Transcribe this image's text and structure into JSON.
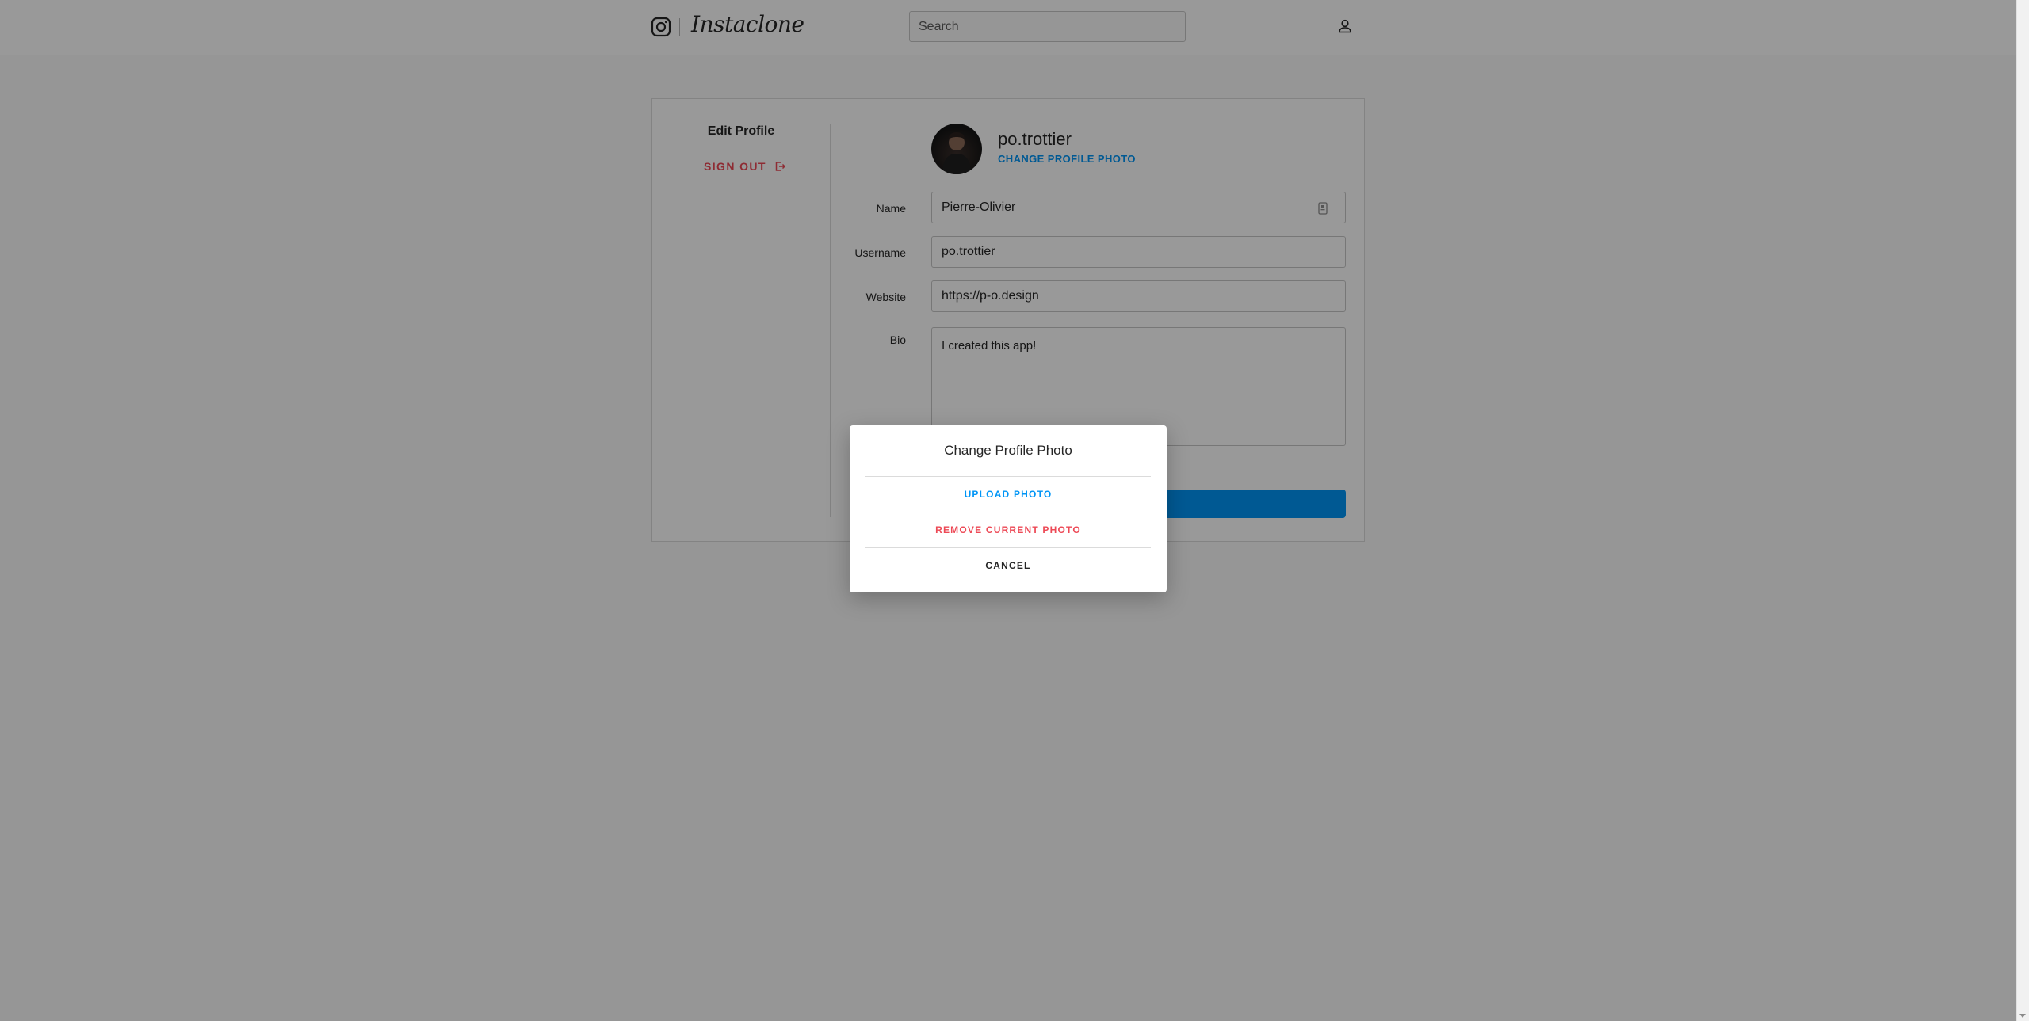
{
  "header": {
    "app_name": "Instaclone",
    "search_placeholder": "Search"
  },
  "sidebar": {
    "title": "Edit Profile",
    "sign_out": "SIGN OUT"
  },
  "profile": {
    "username": "po.trottier",
    "change_photo": "CHANGE PROFILE PHOTO",
    "fields": {
      "name_label": "Name",
      "name_value": "Pierre-Olivier",
      "username_label": "Username",
      "username_value": "po.trottier",
      "website_label": "Website",
      "website_value": "https://p-o.design",
      "bio_label": "Bio",
      "bio_value": "I created this app!"
    }
  },
  "modal": {
    "title": "Change Profile Photo",
    "upload": "UPLOAD PHOTO",
    "remove": "REMOVE CURRENT PHOTO",
    "cancel": "CANCEL"
  },
  "colors": {
    "accent": "#0095f6",
    "danger": "#ed4956"
  }
}
